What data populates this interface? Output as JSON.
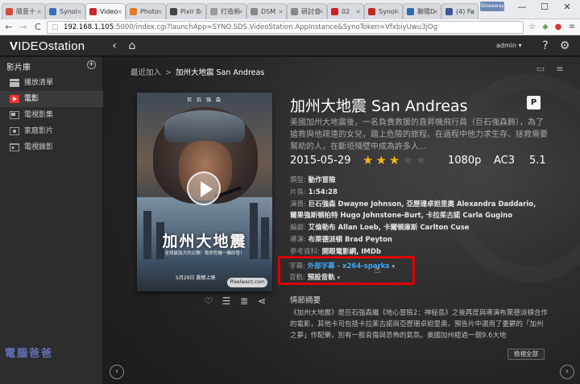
{
  "browser": {
    "tabs": [
      {
        "label": "隨意十",
        "color": "#d64a3a"
      },
      {
        "label": "Synol",
        "color": "#3b6fb6"
      },
      {
        "label": "Video",
        "color": "#c62828"
      },
      {
        "label": "Photo",
        "color": "#e07b22"
      },
      {
        "label": "Pixlr E",
        "color": "#444444"
      },
      {
        "label": "打造新",
        "color": "#999999"
      },
      {
        "label": "DSM",
        "color": "#888888"
      },
      {
        "label": "研討會",
        "color": "#888888"
      },
      {
        "label": "02",
        "color": "#cc2222"
      },
      {
        "label": "Synol",
        "color": "#c62828"
      },
      {
        "label": "聯陽D",
        "color": "#2a6bb3"
      },
      {
        "label": "(4) Fa",
        "color": "#3b5998"
      }
    ],
    "tab_close": "×",
    "profile_label": "Giveaway",
    "window_controls": {
      "minimize": "—",
      "maximize": "☐",
      "close": "✕"
    },
    "address": {
      "host": "192.168.1.105",
      "path": ":5000/index.cgi?launchApp=SYNO.SDS.VideoStation.AppInstance&SynoToken=VfxbiyUwu3jOg"
    },
    "nav": {
      "back": "←",
      "forward": "→",
      "reload": "C"
    }
  },
  "app": {
    "logo_prefix": "V",
    "logo_rest": "IDEOstation",
    "user": "admin",
    "user_caret": "▾"
  },
  "sidebar": {
    "title": "影片庫",
    "items": [
      {
        "label": "播放清單"
      },
      {
        "label": "電影"
      },
      {
        "label": "電視影集"
      },
      {
        "label": "家庭影片"
      },
      {
        "label": "電視錄影"
      }
    ]
  },
  "breadcrumb": {
    "root": "最近加入",
    "sep": ">",
    "current": "加州大地震 San Andreas"
  },
  "poster": {
    "names": "巨 石 強 森",
    "title": "加州大地震",
    "tagline": "全球最強大的災難！致命危機一觸即發！",
    "date": "5月29日 震撼上映",
    "watermark": "Pixelwant.com"
  },
  "movie": {
    "title": "加州大地震 San Andreas",
    "rating_badge": "P",
    "summary": "美國加州大地震後，一名負責救援的直昇機飛行員（巨石強森飾），為了搶救與他疏遠的女兒，踏上危險的旅程。在過程中他力求生存、拯救需要幫助的人，在斷垣殘壁中成為許多人...",
    "date": "2015-05-29",
    "rating": 3,
    "rating_max": 5,
    "resolution": "1080p",
    "audio_codec": "AC3",
    "channels": "5.1"
  },
  "details": {
    "genre_label": "類型:",
    "genre": "動作冒險",
    "runtime_label": "片長:",
    "runtime": "1:54:28",
    "cast_label": "演員:",
    "cast_line1": "巨石強森 Dwayne Johnson, 亞歷珊卓妲里奧 Alexandra Daddario,",
    "cast_line2": "爾果強斯頓柏特 Hugo Johnstone-Burt, 卡拉茱古諾 Carla Gugino",
    "writer_label": "編劇:",
    "writer": "艾倫勒布 Allan Loeb, 卡爾頓庫斯 Carlton Cuse",
    "director_label": "導演:",
    "director": "布萊德派頓 Brad Peyton",
    "ref_label": "參考資料:",
    "ref": "開眼電影網, IMDb",
    "subtitle_label": "字幕:",
    "subtitle": "外部字幕 - x264-sparks",
    "audio_label": "音軌:",
    "audio": "預設音軌",
    "caret": "▾"
  },
  "plot": {
    "title": "情節摘要",
    "text": "《加州大地震》是巨石強森繼《地心冒險2：神秘島》之後再度與導演布萊德派頓合作的電影，其他卡司包括卡拉茱古諾與亞歷珊卓妲里奧，預告片中選用了憂鬱的「加州之夢」作配樂，別有一股哀傷與恐怖的氣氛。美國加州經過一個9.6大地"
  },
  "buttons": {
    "view_all": "檢視全部"
  },
  "watermark": "電腦爸爸"
}
